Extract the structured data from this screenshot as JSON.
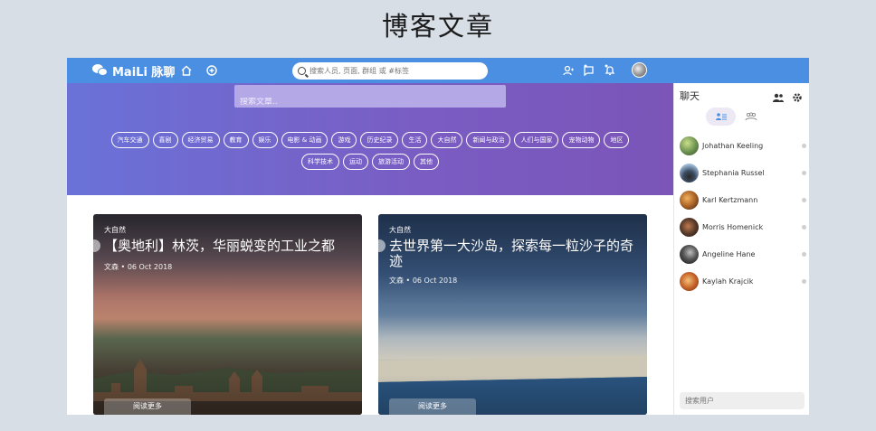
{
  "page_title": "博客文章",
  "topbar": {
    "logo_text": "MaiLi 脉聊",
    "search_placeholder": "搜索人员, 页面, 群组 或 #标签",
    "colors": {
      "bar": "#4a8fe2"
    }
  },
  "hero": {
    "search_placeholder": "搜索文章..",
    "tags": [
      "汽车交通",
      "喜剧",
      "经济贸易",
      "教育",
      "娱乐",
      "电影 & 动画",
      "游戏",
      "历史纪录",
      "生活",
      "大自然",
      "新闻与政治",
      "人们与国家",
      "宠物动物",
      "地区",
      "科学技术",
      "运动",
      "旅游活动",
      "其他"
    ]
  },
  "articles": [
    {
      "category": "大自然",
      "title": "【奥地利】林茨，华丽蜕变的工业之都",
      "author": "文森",
      "date": "06 Oct 2018",
      "read_more": "阅读更多"
    },
    {
      "category": "大自然",
      "title": "去世界第一大沙岛，探索每一粒沙子的奇迹",
      "author": "文森",
      "date": "06 Oct 2018",
      "read_more": "阅读更多"
    }
  ],
  "chat": {
    "title": "聊天",
    "search_placeholder": "搜索用户",
    "contacts": [
      {
        "name": "Johathan Keeling",
        "avatar_color": "#6a8f4e"
      },
      {
        "name": "Stephania Russel",
        "avatar_color": "#7aa0c8"
      },
      {
        "name": "Karl Kertzmann",
        "avatar_color": "#b36a2a"
      },
      {
        "name": "Morris Homenick",
        "avatar_color": "#5a3b2a"
      },
      {
        "name": "Angeline Hane",
        "avatar_color": "#333333"
      },
      {
        "name": "Kaylah Krajcik",
        "avatar_color": "#c8652a"
      }
    ]
  }
}
